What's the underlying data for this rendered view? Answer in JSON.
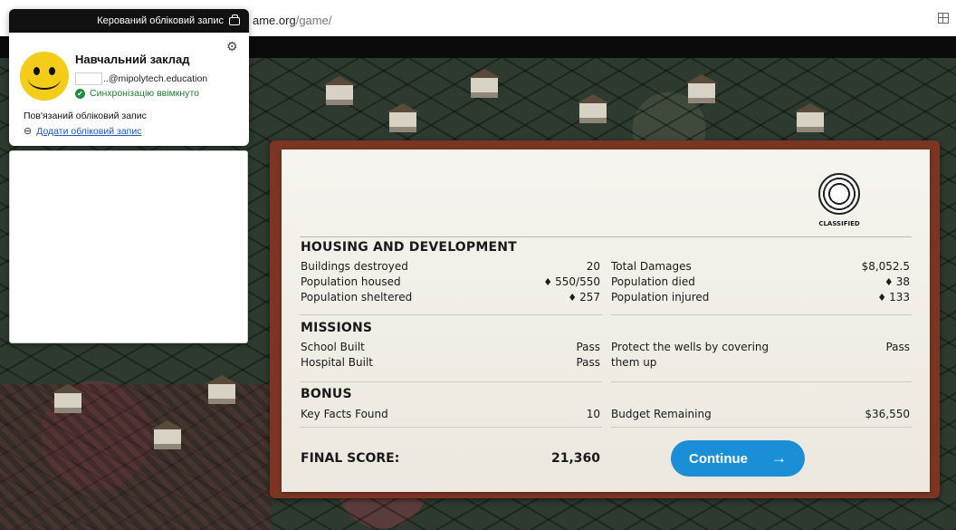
{
  "browser": {
    "url_visible": "ame.org",
    "url_path": "/game/"
  },
  "account_popup": {
    "header": "Керований обліковий запис",
    "org_name": "Навчальний заклад",
    "email": "..@mipolytech.education",
    "sync_status": "Синхронізацію ввімкнуто",
    "linked_title": "Пов'язаний обліковий запис",
    "add_account": "Додати обліковий запис"
  },
  "report": {
    "classified": "CLASSIFIED",
    "housing": {
      "title": "HOUSING AND DEVELOPMENT",
      "left": [
        {
          "label": "Buildings destroyed",
          "value": "20",
          "person": false
        },
        {
          "label": "Population housed",
          "value": "550/550",
          "person": true
        },
        {
          "label": "Population sheltered",
          "value": "257",
          "person": true
        }
      ],
      "right": [
        {
          "label": "Total Damages",
          "value": "$8,052.5",
          "person": false
        },
        {
          "label": "Population died",
          "value": "38",
          "person": true
        },
        {
          "label": "Population injured",
          "value": "133",
          "person": true
        }
      ]
    },
    "missions": {
      "title": "MISSIONS",
      "left": [
        {
          "label": "School Built",
          "value": "Pass"
        },
        {
          "label": "Hospital Built",
          "value": "Pass"
        }
      ],
      "right_label_1": "Protect the wells by covering",
      "right_label_2": "them up",
      "right_value": "Pass"
    },
    "bonus": {
      "title": "BONUS",
      "left_label": "Key Facts Found",
      "left_value": "10",
      "right_label": "Budget Remaining",
      "right_value": "$36,550"
    },
    "final_label": "FINAL SCORE:",
    "final_value": "21,360",
    "continue_label": "Continue",
    "person_glyph": "♦"
  }
}
